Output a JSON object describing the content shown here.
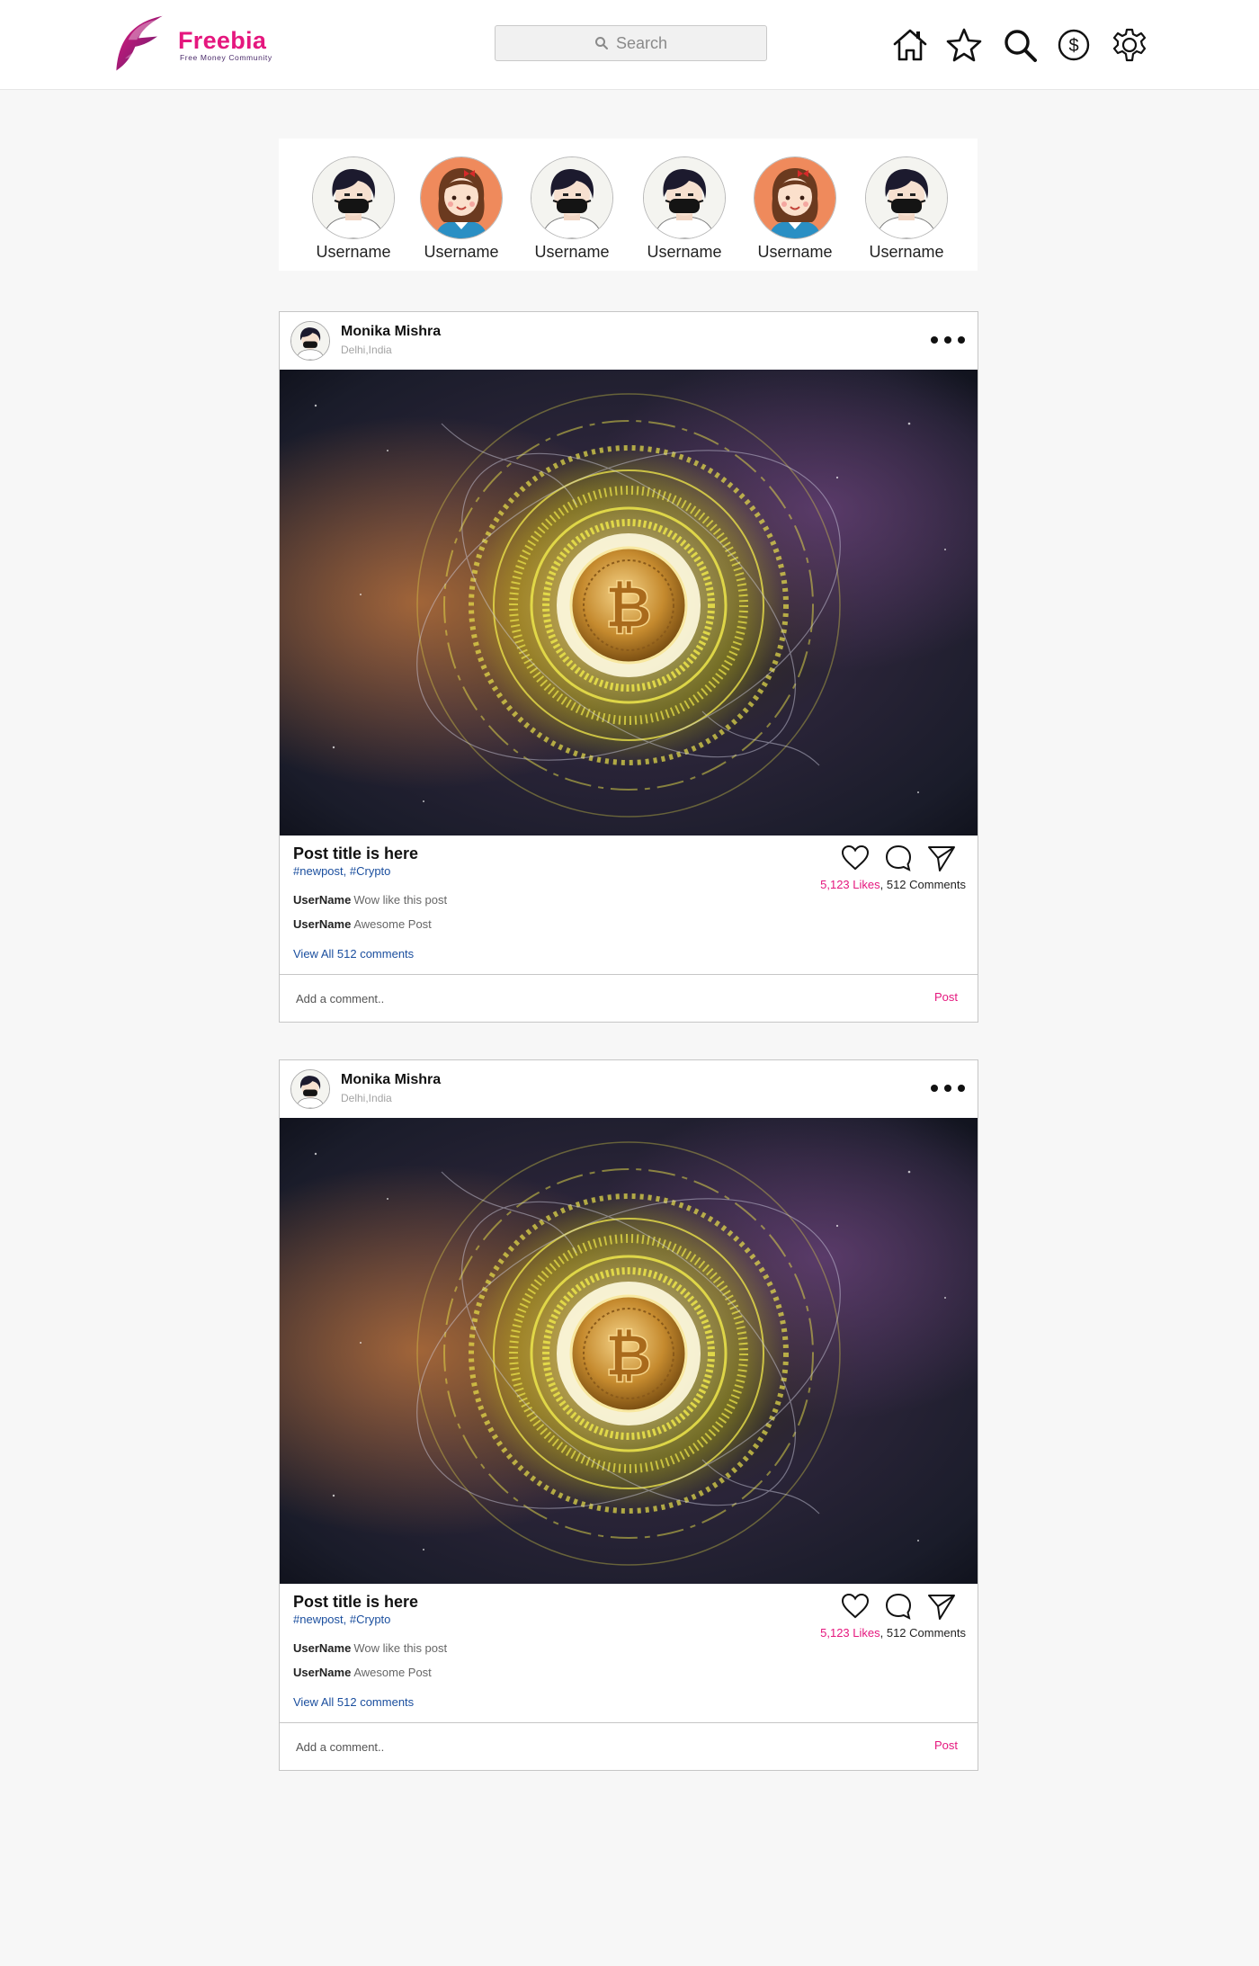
{
  "brand": {
    "name": "Freebia",
    "tagline": "Free Money Community",
    "accent": "#e5177e",
    "deep": "#5b1f6e"
  },
  "search": {
    "placeholder": "Search",
    "icon": "search-icon"
  },
  "nav": [
    {
      "name": "home",
      "icon": "home-icon"
    },
    {
      "name": "favorites",
      "icon": "star-icon"
    },
    {
      "name": "search",
      "icon": "magnifier-icon"
    },
    {
      "name": "wallet",
      "icon": "dollar-icon"
    },
    {
      "name": "settings",
      "icon": "gear-icon"
    }
  ],
  "stories": [
    {
      "username": "Username",
      "avatar": "boy-avatar"
    },
    {
      "username": "Username",
      "avatar": "girl-avatar"
    },
    {
      "username": "Username",
      "avatar": "boy-avatar"
    },
    {
      "username": "Username",
      "avatar": "boy-avatar"
    },
    {
      "username": "Username",
      "avatar": "girl-avatar"
    },
    {
      "username": "Username",
      "avatar": "boy-avatar"
    }
  ],
  "posts": [
    {
      "author": "Monika Mishra",
      "location": "Delhi,India",
      "image": "bitcoin-galaxy-image",
      "title": "Post title is here",
      "tags": "#newpost, #Crypto",
      "likes": "5,123 Likes",
      "comments_count": ", 512 Comments",
      "comments": [
        {
          "user": "UserName",
          "text": "Wow like this post"
        },
        {
          "user": "UserName",
          "text": "Awesome Post"
        }
      ],
      "view_all": "View All 512 comments",
      "comment_placeholder": "Add a comment..",
      "post_label": "Post"
    },
    {
      "author": "Monika Mishra",
      "location": "Delhi,India",
      "image": "bitcoin-galaxy-image",
      "title": "Post title is here",
      "tags": "#newpost, #Crypto",
      "likes": "5,123 Likes",
      "comments_count": ", 512 Comments",
      "comments": [
        {
          "user": "UserName",
          "text": "Wow like this post"
        },
        {
          "user": "UserName",
          "text": "Awesome Post"
        }
      ],
      "view_all": "View All 512 comments",
      "comment_placeholder": "Add a comment..",
      "post_label": "Post"
    }
  ]
}
